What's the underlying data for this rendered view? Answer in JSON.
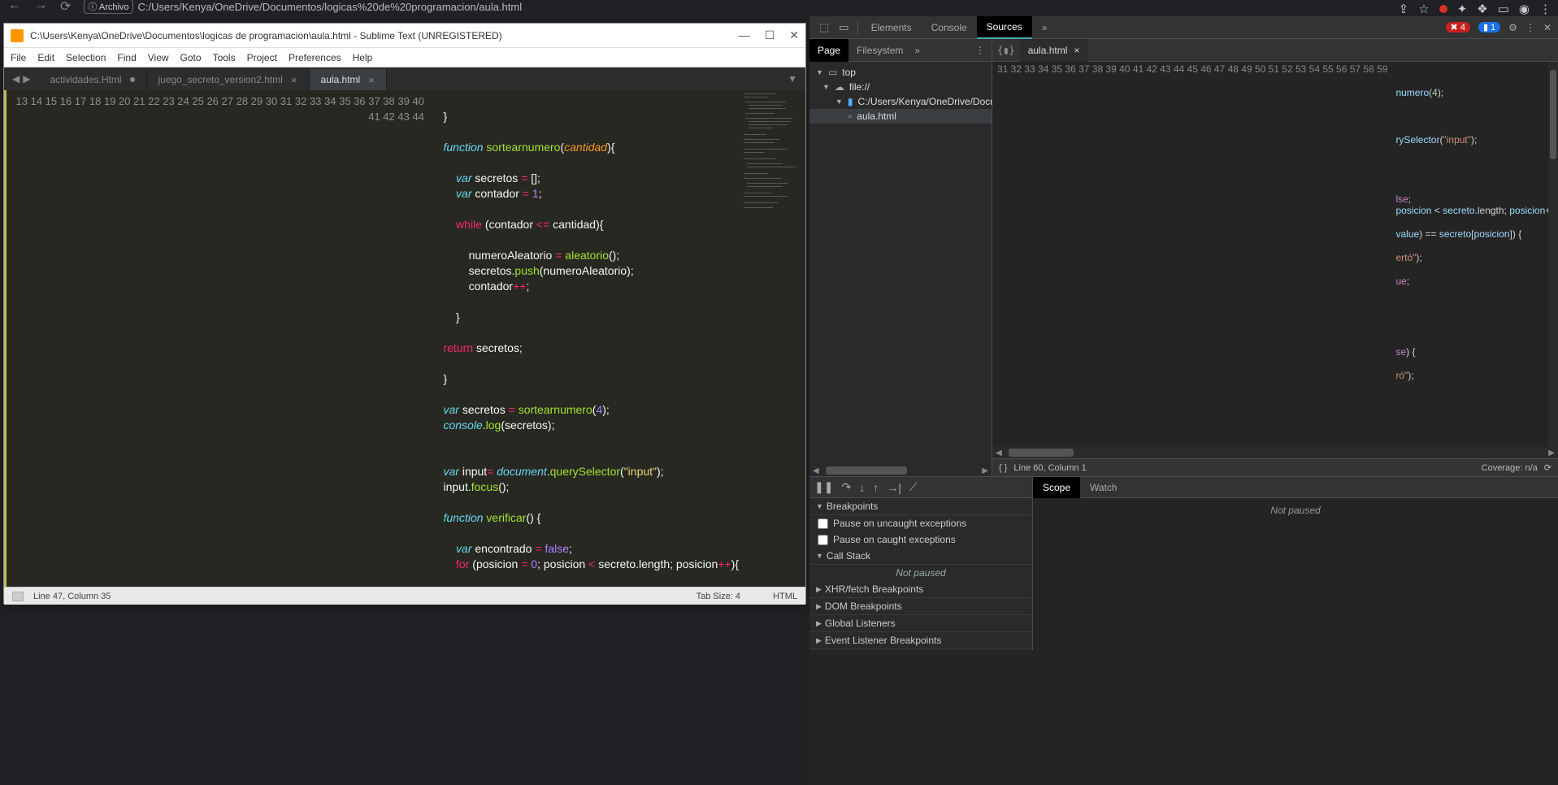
{
  "browser": {
    "url_prefix": "ⓘ Archivo",
    "url": "C:/Users/Kenya/OneDrive/Documentos/logicas%20de%20programacion/aula.html"
  },
  "sublime": {
    "title": "C:\\Users\\Kenya\\OneDrive\\Documentos\\logicas de programacion\\aula.html - Sublime Text (UNREGISTERED)",
    "menu": [
      "File",
      "Edit",
      "Selection",
      "Find",
      "View",
      "Goto",
      "Tools",
      "Project",
      "Preferences",
      "Help"
    ],
    "tabs": [
      {
        "label": "actividades.Html",
        "modified": true,
        "active": false
      },
      {
        "label": "juego_secreto_version2.html",
        "modified": false,
        "active": false,
        "close": "×"
      },
      {
        "label": "aula.html",
        "modified": false,
        "active": true,
        "close": "×"
      }
    ],
    "lines_start": 13,
    "lines_end": 44,
    "status": {
      "pos": "Line 47, Column 35",
      "tab": "Tab Size: 4",
      "lang": "HTML"
    }
  },
  "devtools": {
    "top_tabs": [
      "Elements",
      "Console",
      "Sources"
    ],
    "more": "»",
    "error_count": "4",
    "info_count": "1",
    "nav_tabs": [
      "Page",
      "Filesystem"
    ],
    "file_tab": "aula.html",
    "tree": {
      "top": "top",
      "scheme": "file://",
      "folder": "C:/Users/Kenya/OneDrive/Docu",
      "file": "aula.html"
    },
    "src_lines_start": 31,
    "src_lines_end": 59,
    "src_status": {
      "pos": "Line 60, Column 1",
      "coverage": "Coverage: n/a"
    },
    "breakpoints_hdr": "Breakpoints",
    "pause_unc": "Pause on uncaught exceptions",
    "pause_c": "Pause on caught exceptions",
    "callstack_hdr": "Call Stack",
    "not_paused": "Not paused",
    "xhr_hdr": "XHR/fetch Breakpoints",
    "dom_hdr": "DOM Breakpoints",
    "global_hdr": "Global Listeners",
    "event_hdr": "Event Listener Breakpoints",
    "scope_tabs": [
      "Scope",
      "Watch"
    ],
    "scope_body": "Not paused"
  },
  "chart_data": null
}
